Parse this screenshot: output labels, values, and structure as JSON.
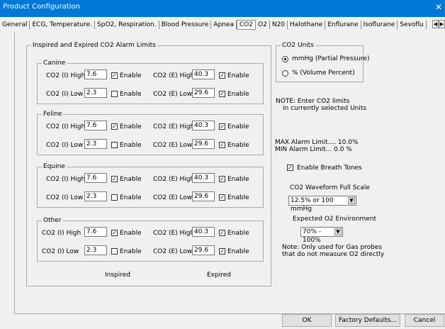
{
  "title": "Product Configuration",
  "tabs": [
    "General",
    "ECG, Temperature.",
    "SpO2, Respiration.",
    "Blood Pressure",
    "Apnea",
    "CO2",
    "O2",
    "N20",
    "Halothane",
    "Enflurane",
    "Isoflurane",
    "Sevoflu"
  ],
  "group_title": "Inspired and Expired CO2 Alarm Limits",
  "enable_label": "Enable",
  "species": [
    {
      "name": "Canine",
      "i_high_label": "CO2 (I) High",
      "i_high": "7.6",
      "i_high_en": true,
      "e_high_label": "CO2 (E) High",
      "e_high": "40.3",
      "e_high_en": true,
      "i_low_label": "CO2 (I) Low",
      "i_low": "2.3",
      "i_low_en": false,
      "e_low_label": "CO2 (E) Low",
      "e_low": "29.6",
      "e_low_en": true
    },
    {
      "name": "Feline",
      "i_high_label": "CO2 (I) High",
      "i_high": "7.6",
      "i_high_en": true,
      "e_high_label": "CO2 (E) High",
      "e_high": "40.3",
      "e_high_en": true,
      "i_low_label": "CO2 (I) Low",
      "i_low": "2.3",
      "i_low_en": false,
      "e_low_label": "CO2 (E) Low",
      "e_low": "29.6",
      "e_low_en": true
    },
    {
      "name": "Equine",
      "i_high_label": "CO2 (I) High",
      "i_high": "7.6",
      "i_high_en": true,
      "e_high_label": "CO2 (E) High",
      "e_high": "40.3",
      "e_high_en": true,
      "i_low_label": "CO2 (I) Low",
      "i_low": "2.3",
      "i_low_en": false,
      "e_low_label": "CO2 (E) Low",
      "e_low": "29.6",
      "e_low_en": true
    },
    {
      "name": "Other",
      "i_high_label": "CO2 (I) High",
      "i_high": "7.6",
      "i_high_en": true,
      "e_high_label": "CO2 (E) High",
      "e_high": "40.3",
      "e_high_en": true,
      "i_low_label": "CO2 (I) Low",
      "i_low": "2.3",
      "i_low_en": false,
      "e_low_label": "CO2 (E) Low",
      "e_low": "29.6",
      "e_low_en": true
    }
  ],
  "inspired_label": "Inspired",
  "expired_label": "Expired",
  "units": {
    "title": "CO2 Units",
    "opt1": "mmHg (Partial Pressure)",
    "opt2": "% (Volume Percent)",
    "selected": 0
  },
  "note_units": "NOTE: Enter CO2 limits",
  "note_units2": "in currently selected Units",
  "max_alarm": "MAX Alarm Limit.... 10.0%",
  "min_alarm": "MIN  Alarm  Limit... 0.0 %",
  "breath_tones": {
    "label": "Enable Breath Tones",
    "checked": true
  },
  "waveform": {
    "label": "CO2 Waveform Full Scale",
    "value": "12.5% or 100 mmHg"
  },
  "o2_env": {
    "label": "Expected O2 Environment",
    "value": "70% - 100%"
  },
  "note_o2": "Note: Only used for Gas probes",
  "note_o2_2": "that do not measure O2 directly",
  "buttons": {
    "ok": "OK",
    "factory": "Factory Defaults...",
    "cancel": "Cancel"
  }
}
